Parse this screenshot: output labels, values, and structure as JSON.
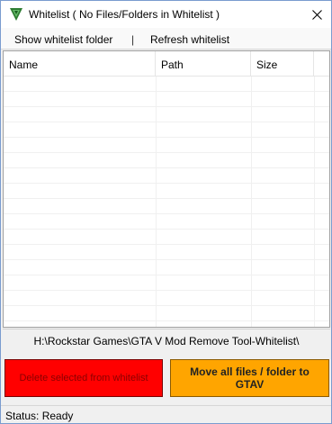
{
  "window": {
    "title": "Whitelist ( No Files/Folders in Whitelist )",
    "app_icon": "green-v-logo-icon",
    "close_icon": "close-icon"
  },
  "menu": {
    "show_folder": "Show whitelist folder",
    "separator": "|",
    "refresh": "Refresh whitelist"
  },
  "list": {
    "columns": [
      "Name",
      "Path",
      "Size"
    ],
    "rows": []
  },
  "path": "H:\\Rockstar Games\\GTA V Mod Remove Tool-Whitelist\\",
  "buttons": {
    "delete_label": "Delete selected from whitelist",
    "move_label": "Move all files / folder to GTAV",
    "delete_color": "#ff0000",
    "move_color": "#ffa500"
  },
  "status": "Status: Ready"
}
